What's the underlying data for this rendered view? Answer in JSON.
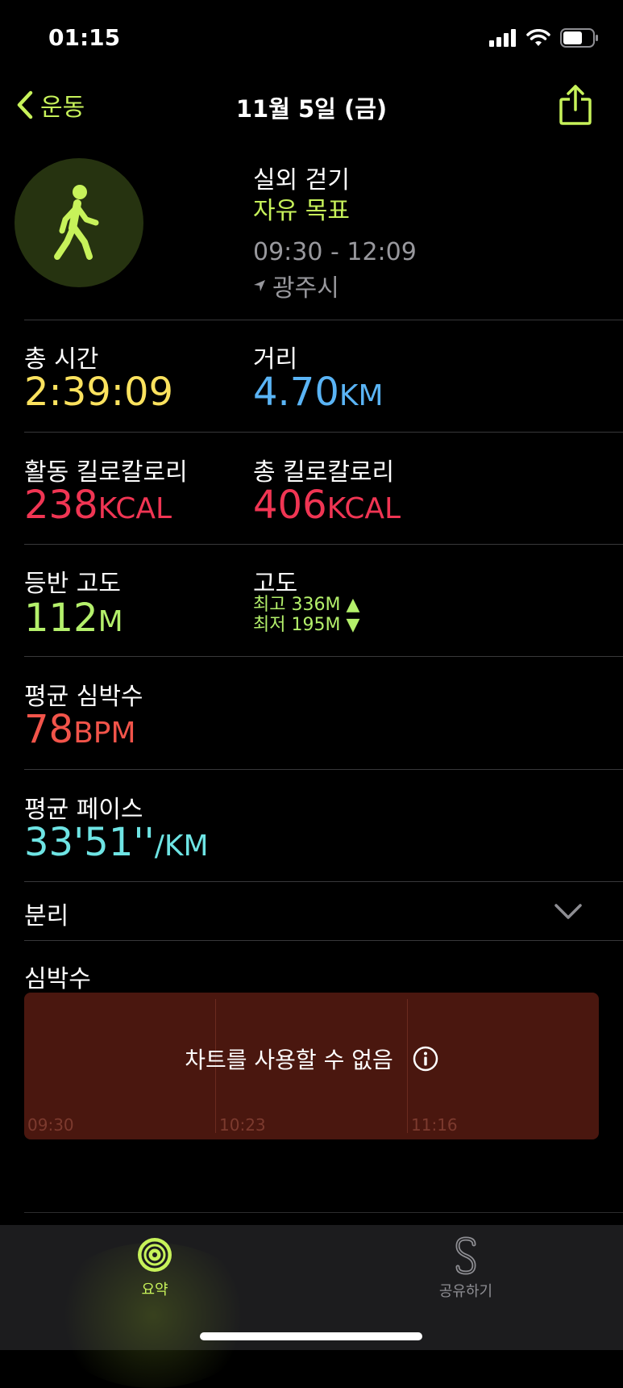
{
  "status_bar": {
    "time": "01:15"
  },
  "nav": {
    "back_label": "운동",
    "title": "11월 5일 (금)"
  },
  "workout": {
    "type": "실외 걷기",
    "goal": "자유 목표",
    "time_range": "09:30 - 12:09",
    "location": "광주시"
  },
  "metrics": {
    "total_time": {
      "label": "총 시간",
      "value": "2:39:09"
    },
    "distance": {
      "label": "거리",
      "value": "4.70",
      "unit": "KM"
    },
    "active_kcal": {
      "label": "활동 킬로칼로리",
      "value": "238",
      "unit": "KCAL"
    },
    "total_kcal": {
      "label": "총 킬로칼로리",
      "value": "406",
      "unit": "KCAL"
    },
    "elevation_gain": {
      "label": "등반 고도",
      "value": "112",
      "unit": "M"
    },
    "elevation": {
      "label": "고도",
      "high": "최고 336M ▲",
      "low": "최저 195M ▼"
    },
    "avg_hr": {
      "label": "평균 심박수",
      "value": "78",
      "unit": "BPM"
    },
    "avg_pace": {
      "label": "평균 페이스",
      "value": "33'51''",
      "unit": "/KM"
    }
  },
  "splits": {
    "label": "분리"
  },
  "heart_rate": {
    "label": "심박수",
    "unavailable": "차트를 사용할 수 없음",
    "ticks": [
      "09:30",
      "10:23",
      "11:16"
    ]
  },
  "tabs": [
    {
      "label": "요약",
      "icon": "activity-rings-icon",
      "color": "#c7f25a"
    },
    {
      "label": "공유하기",
      "icon": "sharing-icon",
      "color": "#8e8e93"
    }
  ]
}
